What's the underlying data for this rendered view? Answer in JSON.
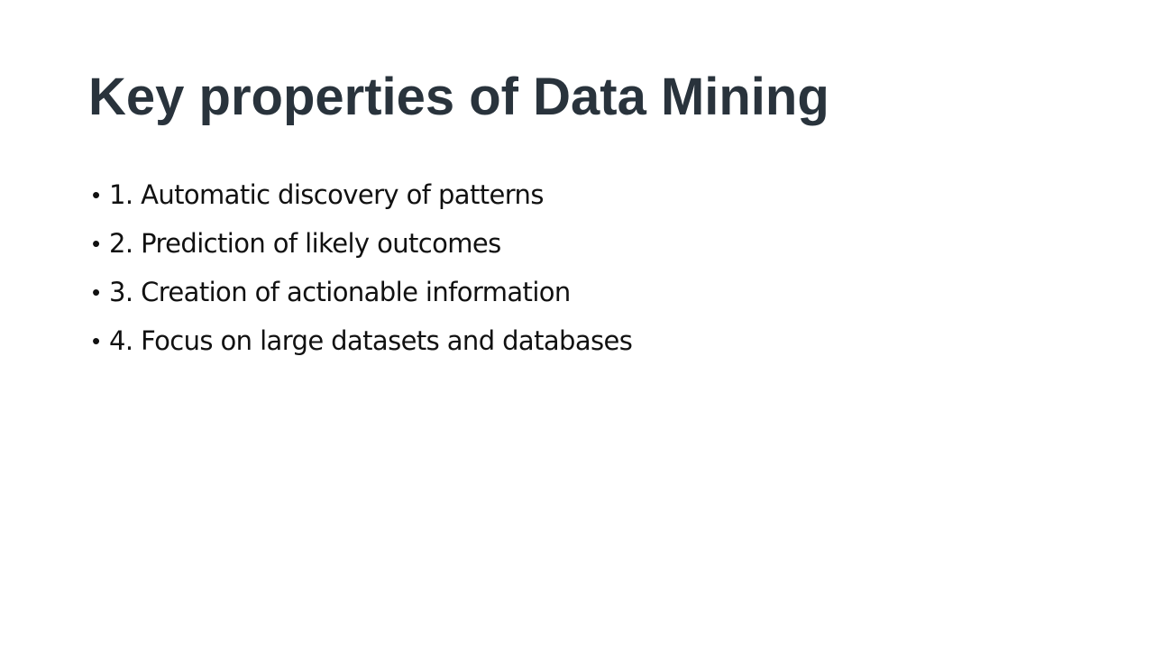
{
  "slide": {
    "title": "Key properties of Data Mining",
    "bullet_symbol": "•",
    "bullets": [
      {
        "text": "1. Automatic discovery of patterns"
      },
      {
        "text": "2. Prediction of likely outcomes"
      },
      {
        "text": "3. Creation of actionable information"
      },
      {
        "text": "4. Focus on large datasets and databases"
      }
    ]
  }
}
